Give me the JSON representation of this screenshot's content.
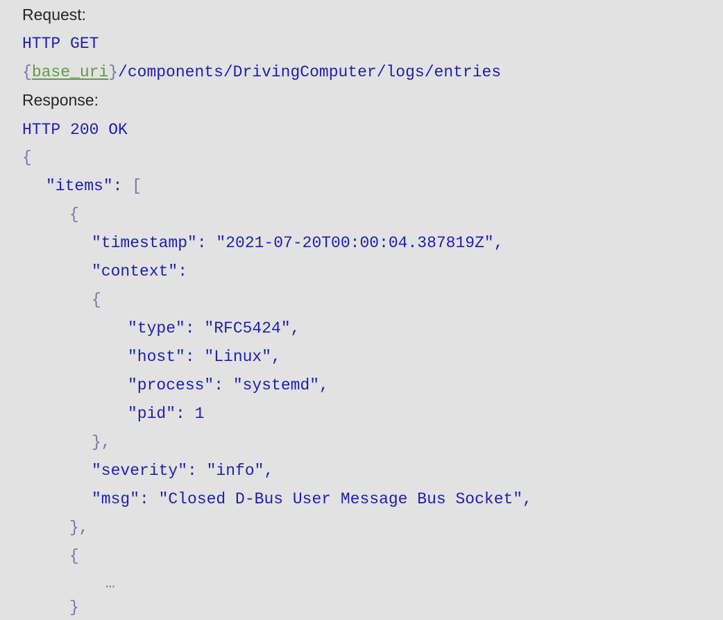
{
  "request": {
    "label": "Request:",
    "method_line": "HTTP GET",
    "uri_open": "{",
    "uri_var": "base_uri",
    "uri_close": "}",
    "uri_path": "/components/DrivingComputer/logs/entries"
  },
  "response": {
    "label": "Response:",
    "status_line": "HTTP 200 OK",
    "body": [
      {
        "text": "{",
        "kind": "punct"
      },
      {
        "text": "\"items\": [",
        "kind": "mixed",
        "key": "\"items\": ",
        "rest": "["
      },
      {
        "text": "{",
        "kind": "punct"
      },
      {
        "text": "\"timestamp\": \"2021-07-20T00:00:04.387819Z\",",
        "kind": "str"
      },
      {
        "text": "\"context\":",
        "kind": "str"
      },
      {
        "text": "{",
        "kind": "punct"
      },
      {
        "text": "\"type\": \"RFC5424\",",
        "kind": "str"
      },
      {
        "text": "\"host\": \"Linux\",",
        "kind": "str"
      },
      {
        "text": "\"process\": \"systemd\",",
        "kind": "str"
      },
      {
        "text": "\"pid\": 1",
        "kind": "str"
      },
      {
        "text": "},",
        "kind": "punct"
      },
      {
        "text": "\"severity\": \"info\",",
        "kind": "str"
      },
      {
        "text": "\"msg\": \"Closed D-Bus User Message Bus Socket\",",
        "kind": "str"
      },
      {
        "text": "},",
        "kind": "punct"
      },
      {
        "text": "{",
        "kind": "punct"
      },
      {
        "text": "…",
        "kind": "punct"
      },
      {
        "text": "}",
        "kind": "punct"
      }
    ]
  }
}
